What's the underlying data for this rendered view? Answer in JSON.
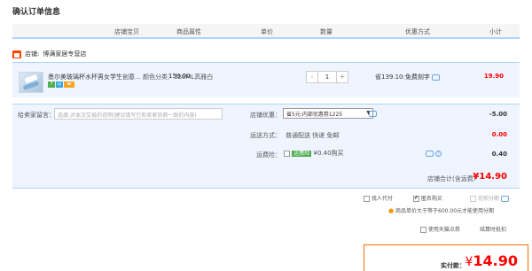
{
  "page_title": "确认订单信息",
  "columns": [
    "店铺宝贝",
    "商品属性",
    "单价",
    "数量",
    "优惠方式",
    "小计"
  ],
  "shop": {
    "label": "店铺:",
    "name": "博满家居专营店"
  },
  "item": {
    "name": "墨尔美玻璃杯水杯男女学生创意...",
    "attr": "颜色分类：320ML高雅白",
    "price": "159.00",
    "qty": "1",
    "qty_minus": "-",
    "qty_plus": "+",
    "discount": "省139.10:免费刻字",
    "subtotal": "19.90"
  },
  "panel": {
    "msg_label": "给卖家留言：",
    "msg_placeholder": "选填:对本次交易的说明(建议填写已和卖家协商一致的内容)",
    "coupon_label": "店铺优惠：",
    "coupon_select": "省5元:内部优惠券1225",
    "coupon_value": "-5.00",
    "ship_label": "运送方式：",
    "ship_value": "普通配送 快递 免邮",
    "ship_cost": "0.00",
    "insure_label": "运费险：",
    "insure_tag": "运费险",
    "insure_text": "¥0.40购买",
    "insure_cost": "0.40",
    "shop_total_label": "店铺合计(含运费)",
    "shop_total": "¥14.90"
  },
  "options": {
    "proxy": "找人代付",
    "anonymous": "匿名购买",
    "installment": "花呗分期",
    "tip": "商品单价大于等于600.00元才能使用分期",
    "tmall_points": "使用天猫点券",
    "pay_later": "结算时抵扣"
  },
  "final": {
    "label": "实付款：",
    "currency": "¥",
    "amount": "14.90"
  },
  "colors": {
    "accent": "#ff0000",
    "border": "#b2d1ff",
    "panel_bg": "#eef5ff",
    "final_border": "#ff6e00"
  }
}
